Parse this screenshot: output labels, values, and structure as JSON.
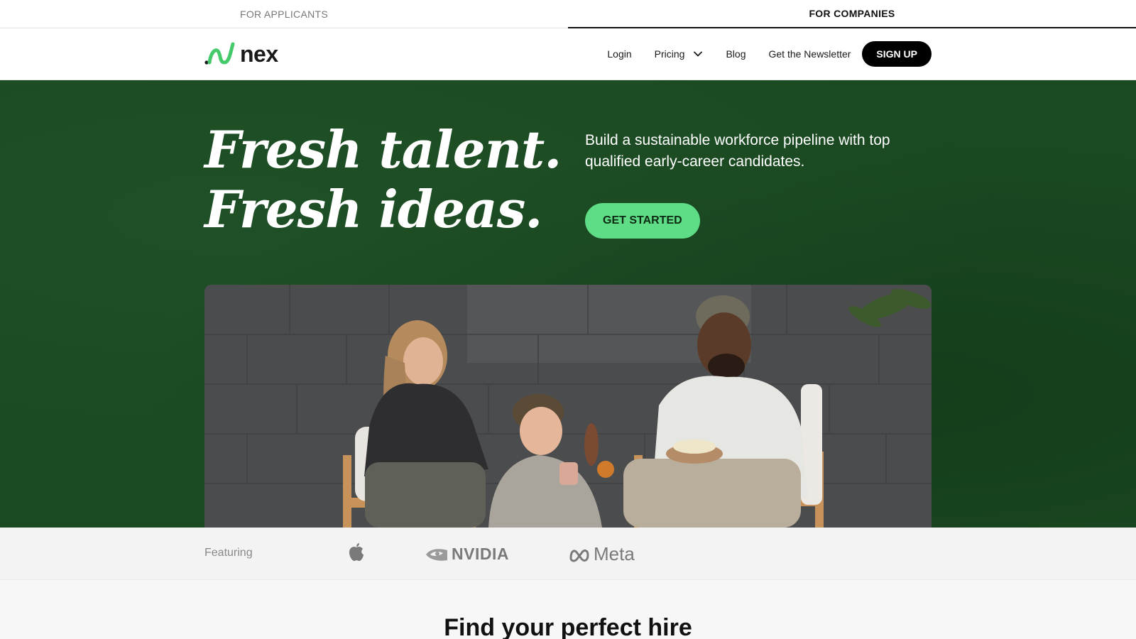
{
  "audience_tabs": [
    {
      "label": "FOR APPLICANTS",
      "active": false
    },
    {
      "label": "FOR COMPANIES",
      "active": true
    }
  ],
  "header": {
    "logo_text": "nex",
    "logo_icon": "nex-wave-logo-icon",
    "nav": {
      "login": "Login",
      "pricing": "Pricing",
      "blog": "Blog",
      "newsletter": "Get the Newsletter",
      "signup": "SIGN UP"
    }
  },
  "hero": {
    "headline_line1": "Fresh talent.",
    "headline_line2": "Fresh ideas.",
    "subtitle": "Build a sustainable workforce pipeline with top qualified early-career candidates.",
    "cta_label": "GET STARTED",
    "background_color": "#1b4a22",
    "cta_color": "#5fdc86"
  },
  "featuring": {
    "label": "Featuring",
    "logos": [
      "apple-logo-icon",
      "nvidia-logo-icon",
      "meta-logo-icon"
    ],
    "nvidia_text": "NVIDIA",
    "meta_text": "Meta"
  },
  "section": {
    "title": "Find your perfect hire"
  }
}
